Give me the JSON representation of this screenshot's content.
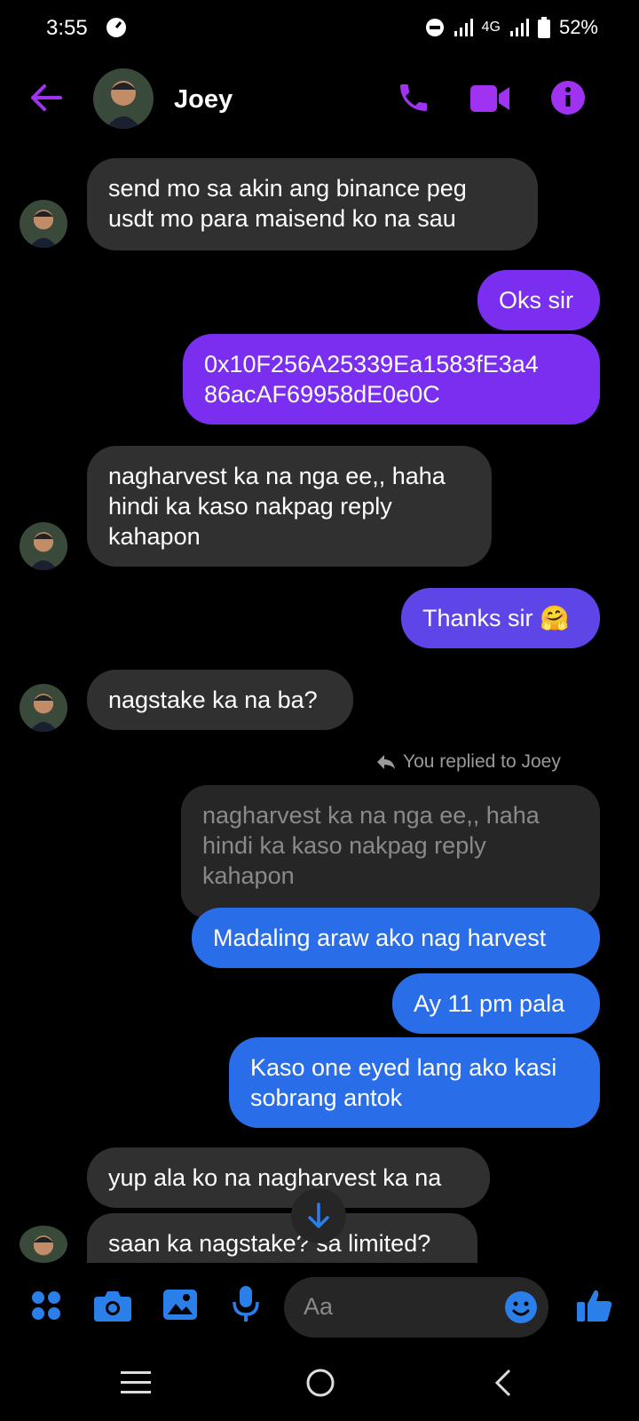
{
  "status_bar": {
    "time": "3:55",
    "network": "4G",
    "battery": "52%"
  },
  "header": {
    "contact_name": "Joey"
  },
  "messages": [
    {
      "from": "them",
      "text": "send mo sa akin ang binance peg\nusdt mo para maisend ko na sau"
    },
    {
      "from": "me",
      "text": "Oks sir"
    },
    {
      "from": "me",
      "text": "0x10F256A25339Ea1583fE3a4\n86acAF69958dE0e0C"
    },
    {
      "from": "them",
      "text": "nagharvest ka na nga ee,, haha\nhindi ka kaso nakpag reply\nkahapon"
    },
    {
      "from": "me",
      "text": "Thanks sir 🤗"
    },
    {
      "from": "them",
      "text": "nagstake ka na ba?"
    },
    {
      "from": "me",
      "text": "Madaling araw ako nag harvest"
    },
    {
      "from": "me",
      "text": "Ay 11 pm pala"
    },
    {
      "from": "me",
      "text": "Kaso one eyed lang ako kasi\nsobrang antok"
    },
    {
      "from": "them",
      "text": "yup ala ko na nagharvest ka na"
    },
    {
      "from": "them",
      "text": "saan ka nagstake? sa limited?"
    }
  ],
  "reply": {
    "label": "You replied to Joey",
    "quoted_text": "nagharvest ka na nga ee,, haha\nhindi ka kaso nakpag reply\nkahapon"
  },
  "composer": {
    "placeholder": "Aa"
  },
  "colors": {
    "accent_purple": "#a033f2",
    "accent_blue": "#2a7fe8"
  }
}
